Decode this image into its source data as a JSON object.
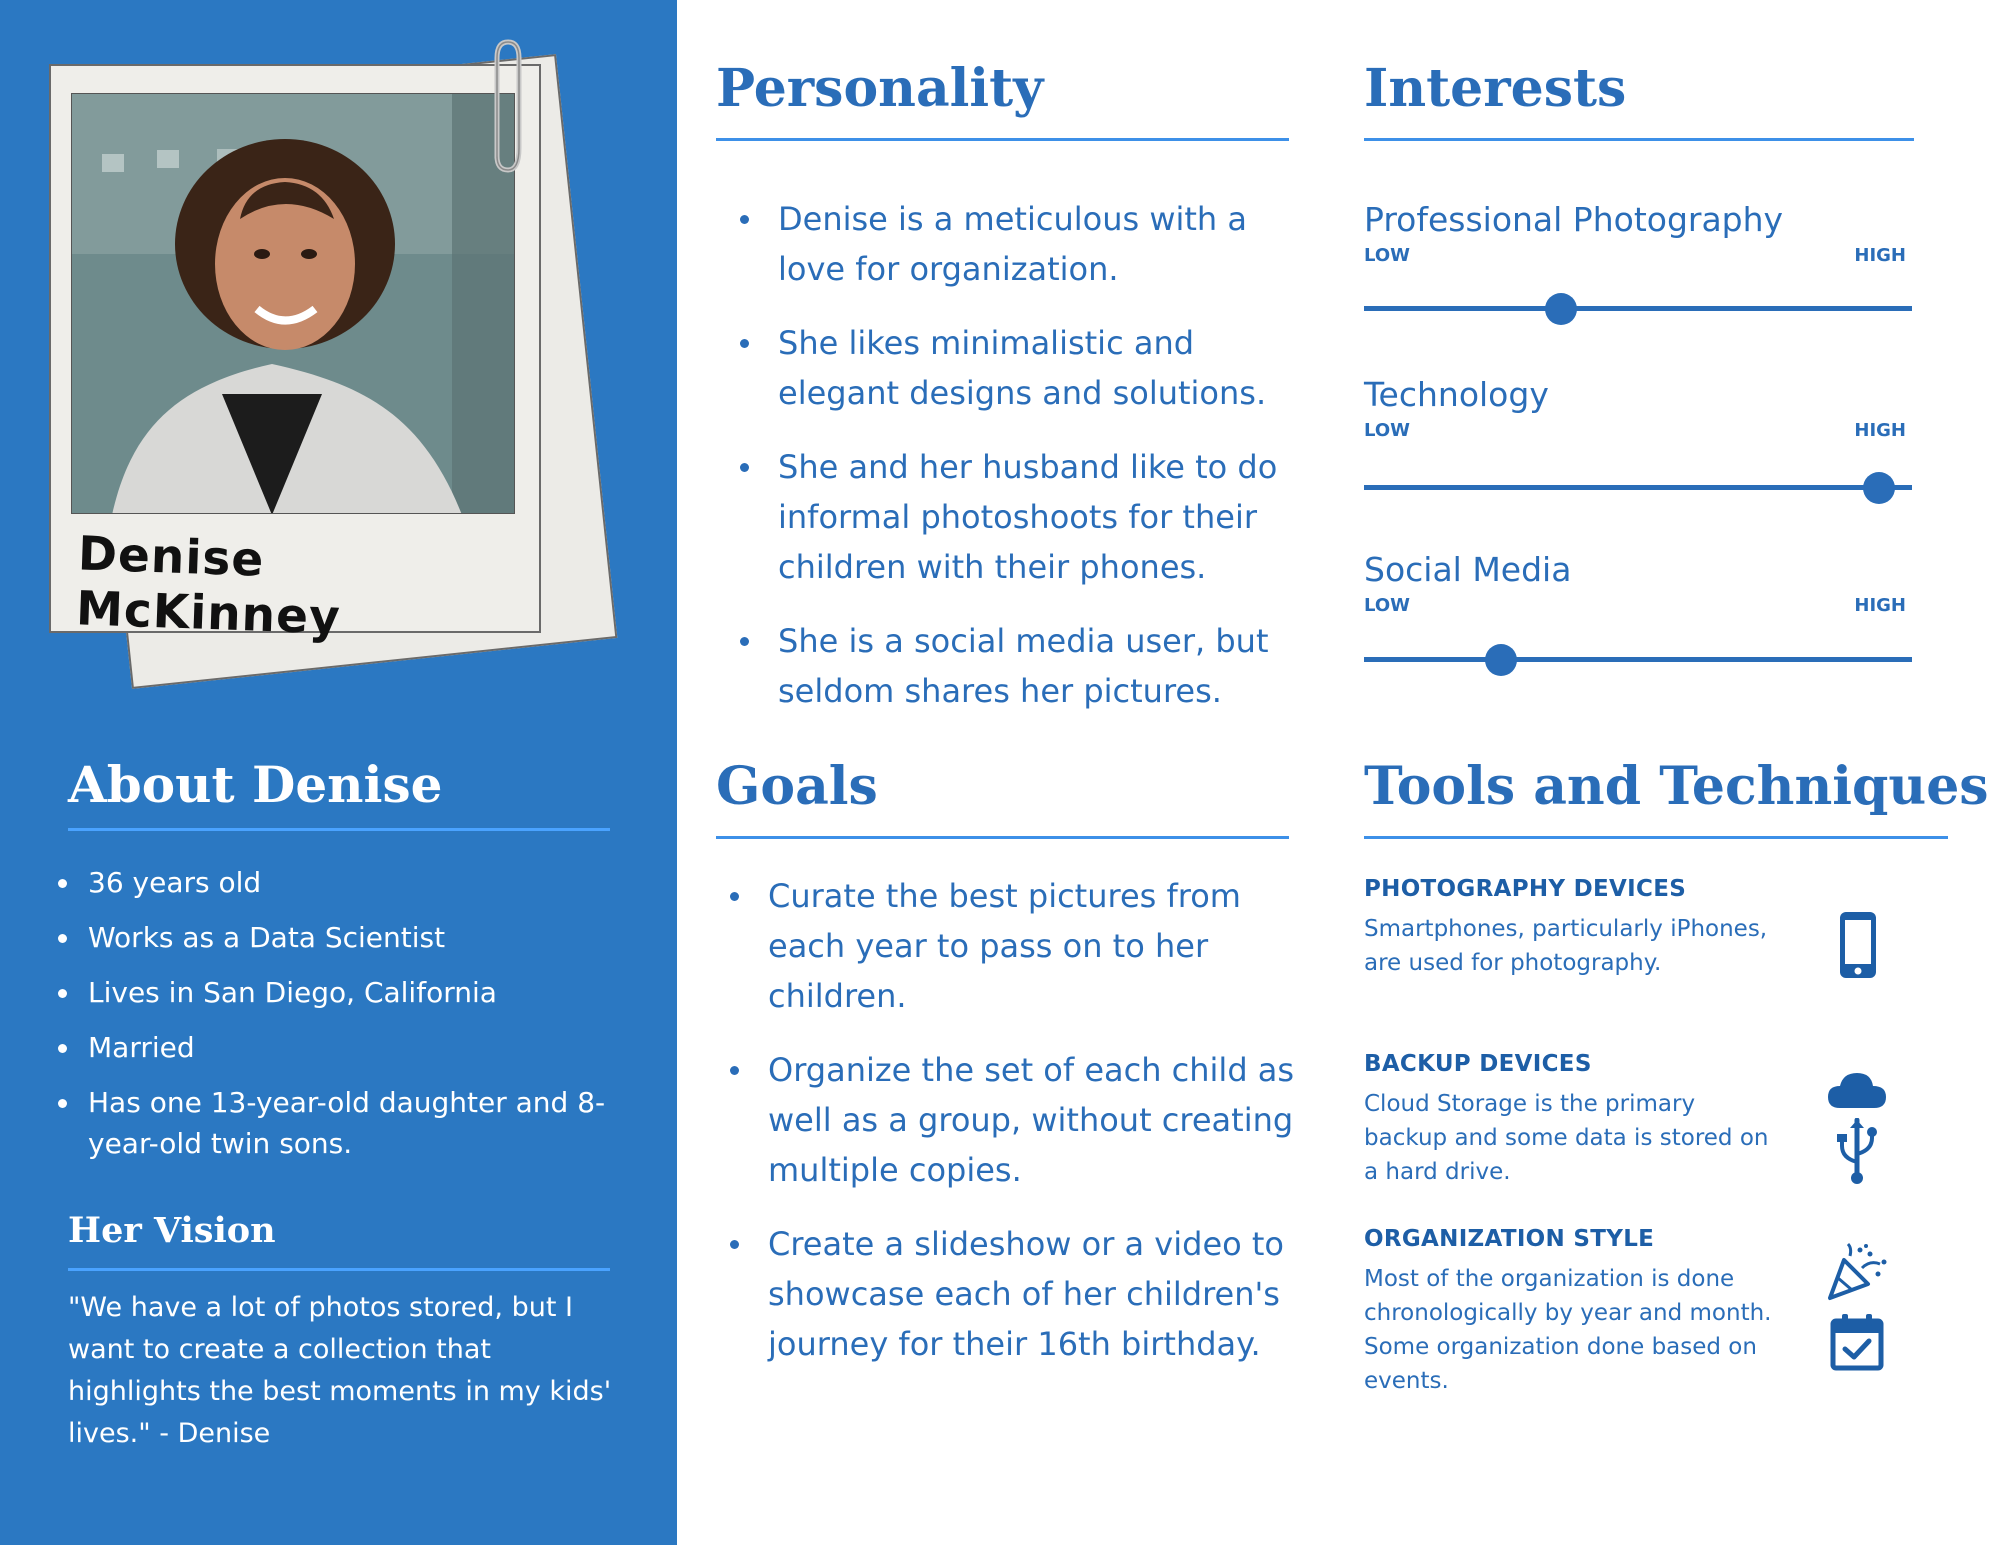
{
  "persona": {
    "name": "Denise McKinney"
  },
  "about": {
    "title": "About Denise",
    "items": [
      "36 years old",
      "Works as a Data Scientist",
      "Lives in San Diego, California",
      "Married",
      "Has one 13-year-old daughter and 8-year-old twin sons."
    ]
  },
  "vision": {
    "title": "Her Vision",
    "quote": "\"We have a lot of photos stored, but I want to create a collection that highlights the best moments in my kids' lives.\" - Denise"
  },
  "personality": {
    "title": "Personality",
    "items": [
      "Denise is a meticulous with a love for organization.",
      "She likes minimalistic and elegant designs and solutions.",
      "She and her husband like to do informal photoshoots for their children with their phones.",
      "She is a social media user, but seldom shares her pictures."
    ]
  },
  "goals": {
    "title": "Goals",
    "items": [
      "Curate the best pictures from each year to pass on to her children.",
      "Organize the set of each child as well as a group, without creating multiple copies.",
      "Create a slideshow or a video to showcase each of her children's journey for their 16th birthday."
    ]
  },
  "interests": {
    "title": "Interests",
    "low_label": "LOW",
    "high_label": "HIGH",
    "items": [
      {
        "label": "Professional Photography",
        "level": 0.36
      },
      {
        "label": "Technology",
        "level": 0.94
      },
      {
        "label": "Social Media",
        "level": 0.25
      }
    ]
  },
  "tools": {
    "title": "Tools and Techniques",
    "items": [
      {
        "title": "PHOTOGRAPHY DEVICES",
        "description": "Smartphones, particularly iPhones, are used for photography.",
        "icons": [
          "smartphone-icon"
        ]
      },
      {
        "title": "BACKUP DEVICES",
        "description": "Cloud Storage is the primary backup and some data is stored on a hard drive.",
        "icons": [
          "cloud-icon",
          "usb-icon"
        ]
      },
      {
        "title": "ORGANIZATION STYLE",
        "description": "Most of the organization is done chronologically by year and month. Some organization done based on events.",
        "icons": [
          "party-popper-icon",
          "calendar-check-icon"
        ]
      }
    ]
  },
  "colors": {
    "sidebar": "#2b78c2",
    "accent": "#2a6db8",
    "rule": "#3d90e8"
  }
}
